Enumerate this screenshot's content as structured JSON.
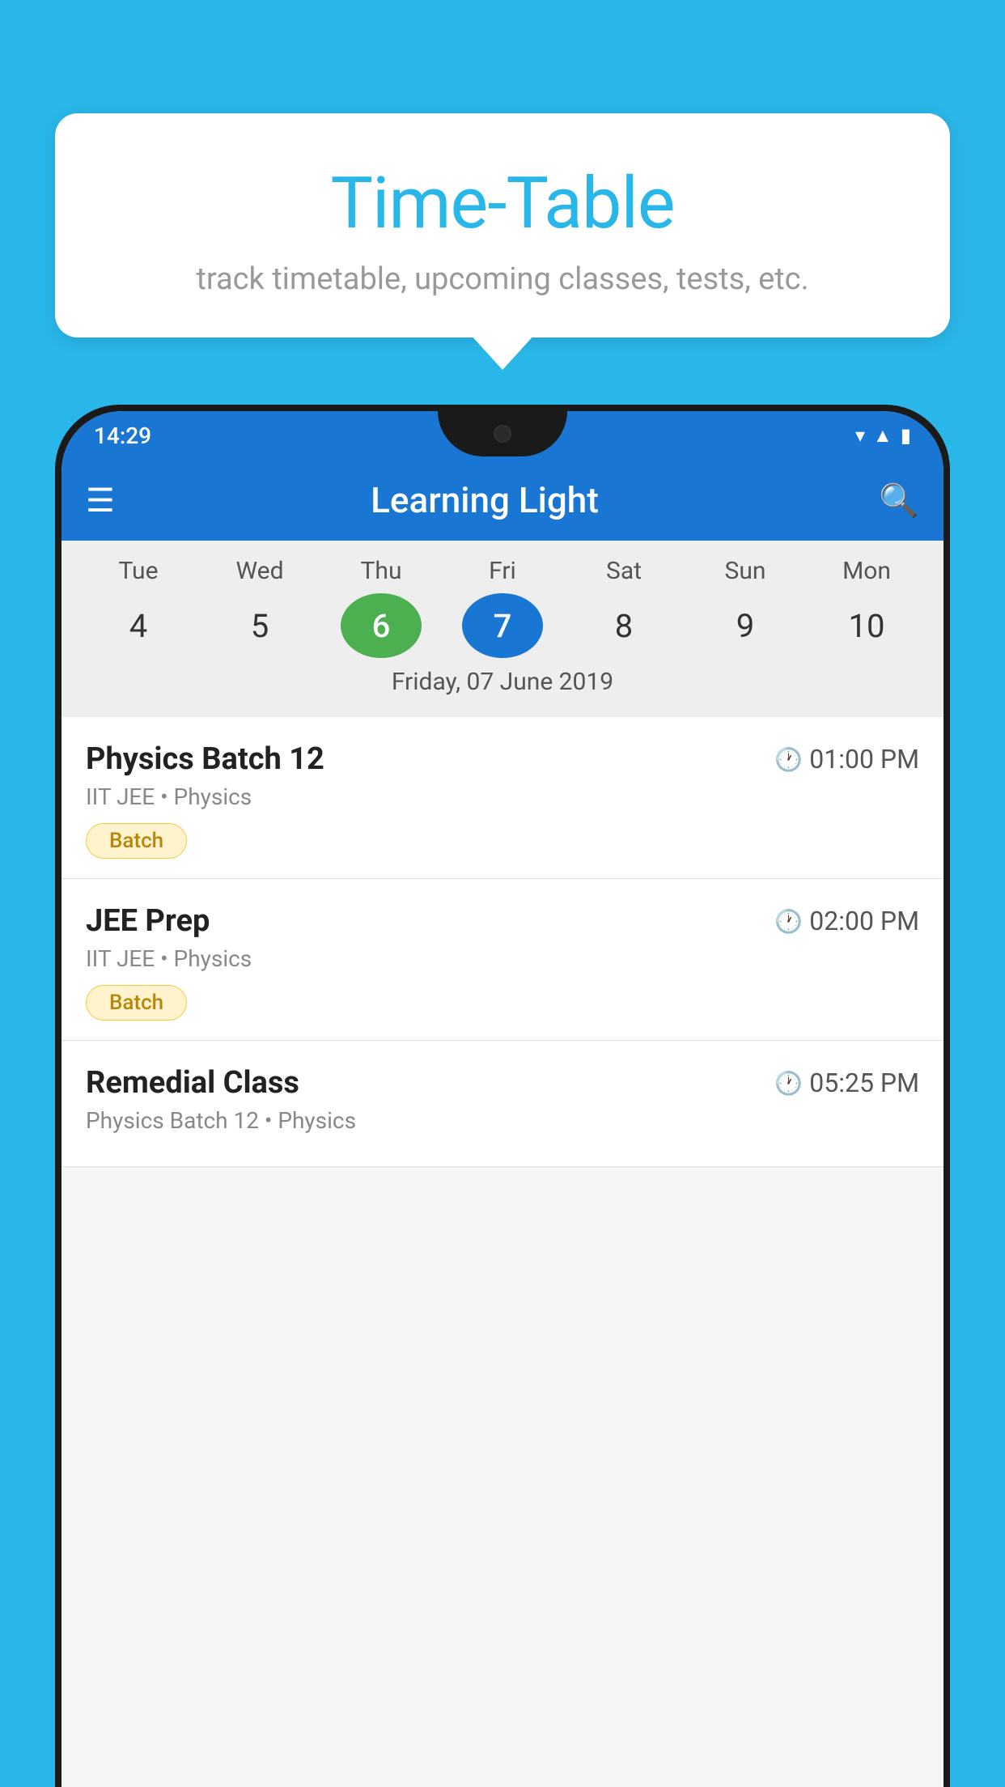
{
  "background_color": "#29B6E8",
  "tooltip": {
    "title": "Time-Table",
    "subtitle": "track timetable, upcoming classes, tests, etc."
  },
  "phone": {
    "status_bar": {
      "time": "14:29",
      "signal_icon": "▲◀█",
      "wifi_icon": "▼"
    },
    "app_bar": {
      "title": "Learning Light",
      "menu_icon": "☰",
      "search_icon": "🔍"
    },
    "calendar": {
      "days": [
        {
          "label": "Tue",
          "num": "4"
        },
        {
          "label": "Wed",
          "num": "5"
        },
        {
          "label": "Thu",
          "num": "6",
          "state": "today"
        },
        {
          "label": "Fri",
          "num": "7",
          "state": "selected"
        },
        {
          "label": "Sat",
          "num": "8"
        },
        {
          "label": "Sun",
          "num": "9"
        },
        {
          "label": "Mon",
          "num": "10"
        }
      ],
      "selected_date_label": "Friday, 07 June 2019"
    },
    "schedule": [
      {
        "title": "Physics Batch 12",
        "time": "01:00 PM",
        "subtitle": "IIT JEE • Physics",
        "badge": "Batch"
      },
      {
        "title": "JEE Prep",
        "time": "02:00 PM",
        "subtitle": "IIT JEE • Physics",
        "badge": "Batch"
      },
      {
        "title": "Remedial Class",
        "time": "05:25 PM",
        "subtitle": "Physics Batch 12 • Physics",
        "badge": null
      }
    ]
  }
}
